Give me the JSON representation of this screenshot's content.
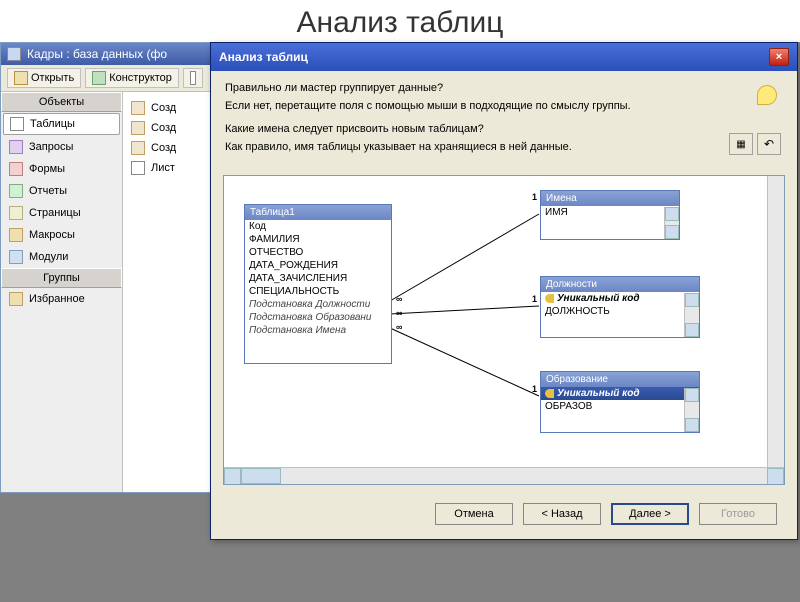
{
  "page_title": "Анализ таблиц",
  "db_window": {
    "title": "Кадры : база данных (фо",
    "toolbar": {
      "open": "Открыть",
      "design": "Конструктор"
    },
    "sidebar_headers": {
      "objects": "Объекты",
      "groups": "Группы"
    },
    "sidebar_items": [
      "Таблицы",
      "Запросы",
      "Формы",
      "Отчеты",
      "Страницы",
      "Макросы",
      "Модули"
    ],
    "groups_items": [
      "Избранное"
    ],
    "list_items": [
      "Созд",
      "Созд",
      "Созд",
      "Лист"
    ]
  },
  "wizard": {
    "title": "Анализ таблиц",
    "prompt1": "Правильно ли мастер группирует данные?",
    "prompt2": "Если нет, перетащите поля с помощью мыши в подходящие по смыслу группы.",
    "prompt3": "Какие имена следует присвоить новым таблицам?",
    "prompt4": "Как правило, имя таблицы указывает на хранящиеся в ней данные.",
    "tables": {
      "t1": {
        "name": "Таблица1",
        "fields": [
          "Код",
          "ФАМИЛИЯ",
          "ОТЧЕСТВО",
          "ДАТА_РОЖДЕНИЯ",
          "ДАТА_ЗАЧИСЛЕНИЯ",
          "СПЕЦИАЛЬНОСТЬ",
          "Подстановка Должности",
          "Подстановка Образовани",
          "Подстановка Имена"
        ]
      },
      "t2": {
        "name": "Имена",
        "fields": [
          "ИМЯ"
        ]
      },
      "t3": {
        "name": "Должности",
        "key_label": "Уникальный код",
        "fields": [
          "ДОЛЖНОСТЬ"
        ]
      },
      "t4": {
        "name": "Образование",
        "key_label": "Уникальный код",
        "fields": [
          "ОБРАЗОВ"
        ]
      }
    },
    "rel_marks": {
      "one": "1",
      "many": "∞"
    },
    "buttons": {
      "cancel": "Отмена",
      "back": "< Назад",
      "next": "Далее >",
      "finish": "Готово"
    }
  }
}
